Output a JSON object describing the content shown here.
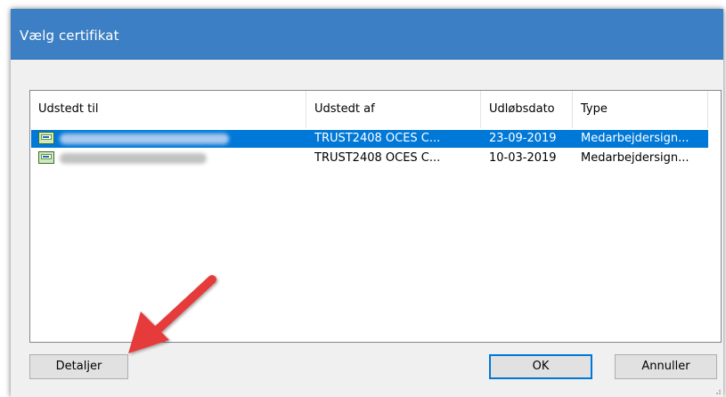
{
  "dialog": {
    "title": "Vælg certifikat"
  },
  "list": {
    "columns": [
      "Udstedt til",
      "Udstedt af",
      "Udløbsdato",
      "Type"
    ],
    "rows": [
      {
        "issued_to": "",
        "issued_by": "TRUST2408 OCES C...",
        "expires": "23-09-2019",
        "type": "Medarbejdersign...",
        "selected": true
      },
      {
        "issued_to": "",
        "issued_by": "TRUST2408 OCES C...",
        "expires": "10-03-2019",
        "type": "Medarbejdersign...",
        "selected": false
      }
    ]
  },
  "buttons": {
    "details": "Detaljer",
    "ok": "OK",
    "cancel": "Annuller"
  },
  "colors": {
    "titlebar": "#3c7fc4",
    "selection": "#0078d7",
    "annotation_arrow": "#e63b3b"
  },
  "icons": {
    "row_icon": "certificate-icon",
    "annotation": "red-arrow-icon"
  }
}
